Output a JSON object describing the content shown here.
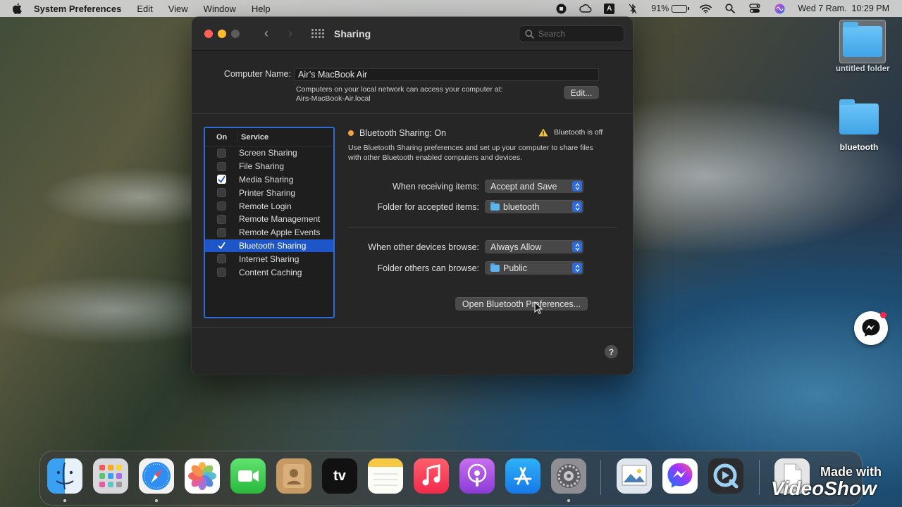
{
  "menubar": {
    "app_name": "System Preferences",
    "menus": [
      "Edit",
      "View",
      "Window",
      "Help"
    ],
    "battery_percent": "91%",
    "battery_level": 0.91,
    "clock": "Wed 7 Ram.  10:29 PM",
    "input_source": "A"
  },
  "window": {
    "title": "Sharing",
    "search_placeholder": "Search",
    "computer_name_label": "Computer Name:",
    "computer_name_value": "Air’s MacBook Air",
    "address_info_line1": "Computers on your local network can access your computer at:",
    "address_info_line2": "Airs-MacBook-Air.local",
    "edit_label": "Edit..."
  },
  "services": {
    "col_on": "On",
    "col_service": "Service",
    "items": [
      {
        "name": "Screen Sharing",
        "on": false
      },
      {
        "name": "File Sharing",
        "on": false
      },
      {
        "name": "Media Sharing",
        "on": true
      },
      {
        "name": "Printer Sharing",
        "on": false
      },
      {
        "name": "Remote Login",
        "on": false
      },
      {
        "name": "Remote Management",
        "on": false
      },
      {
        "name": "Remote Apple Events",
        "on": false
      },
      {
        "name": "Bluetooth Sharing",
        "on": true,
        "selected": true
      },
      {
        "name": "Internet Sharing",
        "on": false
      },
      {
        "name": "Content Caching",
        "on": false
      }
    ]
  },
  "detail": {
    "status": "Bluetooth Sharing: On",
    "status_color": "#f0a43a",
    "warning": "Bluetooth is off",
    "description_line1": "Use Bluetooth Sharing preferences and set up your computer to share files",
    "description_line2": "with other Bluetooth enabled computers and devices.",
    "receiving_label": "When receiving items:",
    "receiving_value": "Accept and Save",
    "accepted_folder_label": "Folder for accepted items:",
    "accepted_folder_value": "bluetooth",
    "browse_label": "When other devices browse:",
    "browse_value": "Always Allow",
    "browse_folder_label": "Folder others can browse:",
    "browse_folder_value": "Public",
    "open_prefs_label": "Open Bluetooth Preferences..."
  },
  "help_label": "?",
  "desktop": {
    "icons": [
      {
        "label": "untitled folder"
      },
      {
        "label": "bluetooth"
      }
    ]
  },
  "dock": {
    "apps": [
      "Finder",
      "Launchpad",
      "Safari",
      "Photos",
      "FaceTime",
      "Contacts",
      "TV",
      "Notes",
      "Music",
      "Podcasts",
      "App Store",
      "System Preferences",
      "Preview",
      "Messenger",
      "QuickTime Player",
      "Documents"
    ],
    "tv_label": "tv"
  },
  "watermark": {
    "line1": "Made with",
    "line2": "VideoShow"
  },
  "colors": {
    "accent": "#2f6bd8",
    "selection": "#1e56c8",
    "window_bg": "#262626"
  }
}
